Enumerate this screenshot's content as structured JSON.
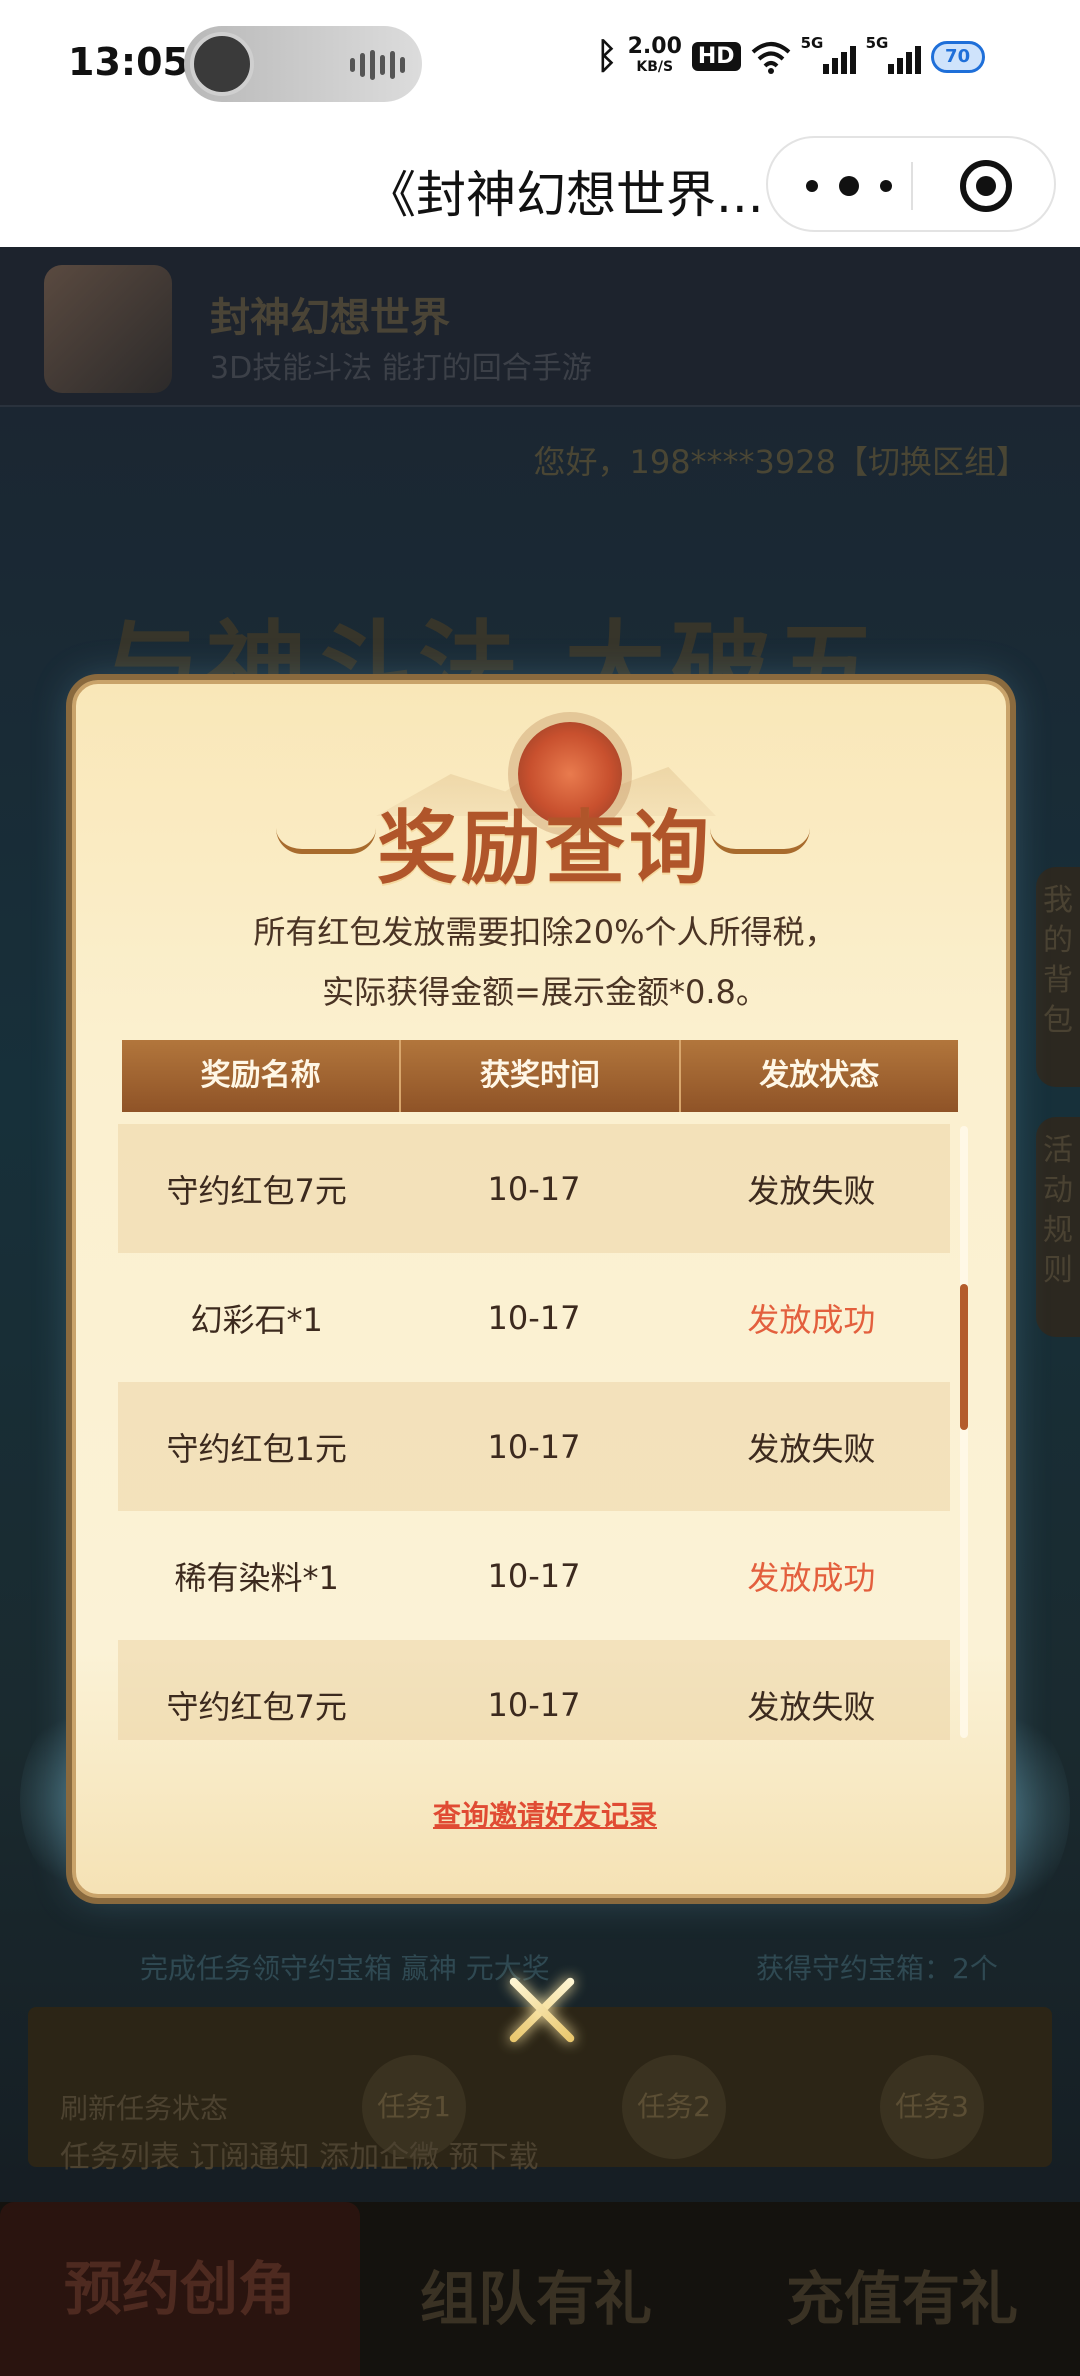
{
  "status_bar": {
    "time": "13:05",
    "net_speed": "2.00",
    "net_unit": "KB/S",
    "hd_badge": "HD",
    "signal1": "5G",
    "signal2": "5G",
    "battery": "70"
  },
  "nav": {
    "title": "《封神幻想世界..."
  },
  "background_page": {
    "app_name": "封神幻想世界",
    "slogan": "3D技能斗法 能打的回合手游",
    "greeting": "您好，198****3928【切换区组】",
    "banner": "与神斗法 大破五",
    "side_tab_backpack": "我的背包",
    "side_tab_rules": "活动规则",
    "task_line": "完成任务领守约宝箱 赢神 元大奖",
    "chest_count": "获得守约宝箱：2个",
    "refresh": "刷新任务状态",
    "tasks": [
      "任务1",
      "任务2",
      "任务3"
    ],
    "task_tabs": "任务列表   订阅通知   添加企微   预下载",
    "bottom_tabs": [
      "预约创角",
      "组队有礼",
      "充值有礼"
    ]
  },
  "modal": {
    "title": "奖励查询",
    "note_line1": "所有红包发放需要扣除20%个人所得税，",
    "note_line2": "实际获得金额=展示金额*0.8。",
    "columns": [
      "奖励名称",
      "获奖时间",
      "发放状态"
    ],
    "rows": [
      {
        "name": "守约红包7元",
        "time": "10-17",
        "status": "发放失败"
      },
      {
        "name": "幻彩石*1",
        "time": "10-17",
        "status": "发放成功"
      },
      {
        "name": "守约红包1元",
        "time": "10-17",
        "status": "发放失败"
      },
      {
        "name": "稀有染料*1",
        "time": "10-17",
        "status": "发放成功"
      },
      {
        "name": "守约红包7元",
        "time": "10-17",
        "status": "发放失败"
      }
    ],
    "invite_link": "查询邀请好友记录"
  },
  "colors": {
    "accent_title": "#b0552a",
    "status_success": "#e35f3d",
    "table_header": "#8f5327",
    "link": "#e04b33"
  }
}
